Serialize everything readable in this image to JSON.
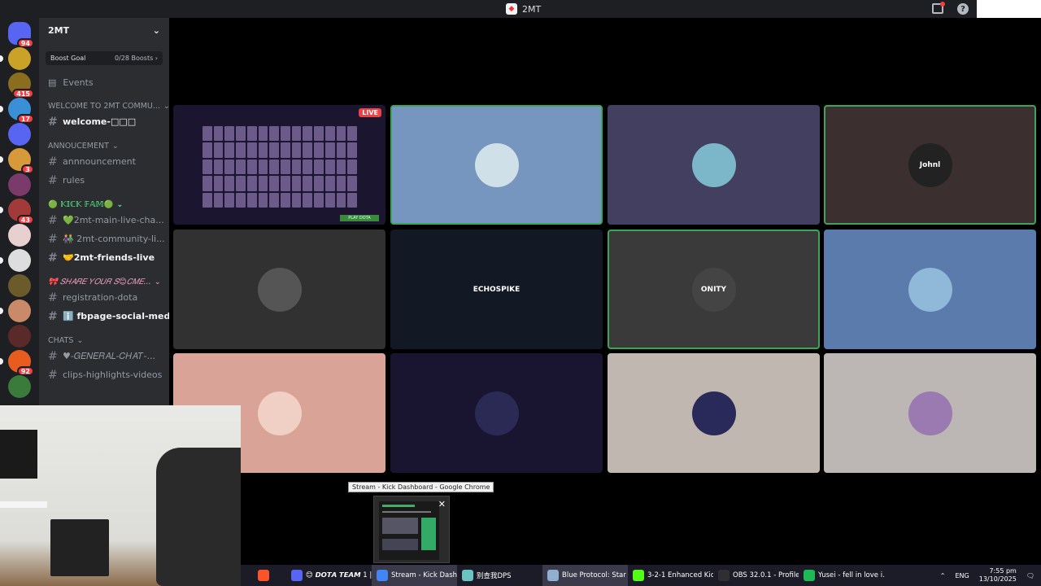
{
  "window": {
    "title": "2MT"
  },
  "server_rail": [
    {
      "name": "discord-home",
      "badge": "94",
      "color": "#5865f2"
    },
    {
      "name": "server-juicy",
      "badge": "",
      "color": "#c9a227"
    },
    {
      "name": "server-gold",
      "badge": "415",
      "color": "#8a6d1f"
    },
    {
      "name": "server-blue",
      "badge": "17",
      "color": "#3a8fd6"
    },
    {
      "name": "server-folder",
      "badge": "",
      "color": "#5865f2"
    },
    {
      "name": "server-2",
      "badge": "3",
      "color": "#d69a3a"
    },
    {
      "name": "server-3",
      "badge": "",
      "color": "#7a3a6a"
    },
    {
      "name": "server-4",
      "badge": "43",
      "color": "#a33a3a"
    },
    {
      "name": "server-cat",
      "badge": "",
      "color": "#e8d0d0"
    },
    {
      "name": "server-gm",
      "badge": "",
      "color": "#dddddd"
    },
    {
      "name": "server-sleepy",
      "badge": "",
      "color": "#6b5a2a"
    },
    {
      "name": "server-man",
      "badge": "",
      "color": "#c98a6a"
    },
    {
      "name": "server-dark",
      "badge": "",
      "color": "#5a2a2a"
    },
    {
      "name": "server-orange",
      "badge": "92",
      "color": "#e85d1f"
    },
    {
      "name": "server-green",
      "badge": "",
      "color": "#3a7a3a"
    }
  ],
  "sidebar": {
    "server_name": "2MT",
    "boost_goal": "Boost Goal",
    "boost_count": "0/28 Boosts",
    "events": "Events",
    "categories": [
      {
        "label": "WELCOME TO 2MT COMMU...",
        "style": "normal",
        "channels": [
          {
            "name": "welcome-□□□",
            "unread": true
          }
        ]
      },
      {
        "label": "ANNOUCEMENT",
        "style": "normal",
        "channels": [
          {
            "name": "annnouncement",
            "unread": false
          },
          {
            "name": "rules",
            "unread": false
          }
        ]
      },
      {
        "label": "🟢 𝕂𝕀ℂ𝕂 𝔽𝔸𝕄🟢",
        "style": "green",
        "channels": [
          {
            "name": "💚2mt-main-live-cha...",
            "unread": false
          },
          {
            "name": "👫 2mt-community-li...",
            "unread": false
          },
          {
            "name": "🤝2mt-friends-live",
            "unread": true
          }
        ]
      },
      {
        "label": "🎀 𝑆𝐻𝐴𝑅𝐸 𝑌𝑂𝑈𝑅 𝑆😊𝐶𝑀𝐸...",
        "style": "pink",
        "channels": [
          {
            "name": "registration-dota",
            "unread": false
          },
          {
            "name": "ℹ️ fbpage-social-medi...",
            "unread": true
          }
        ]
      },
      {
        "label": "CHATS",
        "style": "normal",
        "channels": [
          {
            "name": "♥-𝐺𝐸𝑁𝐸𝑅𝐴𝐿-𝐶𝐻𝐴𝑇-...",
            "unread": false
          },
          {
            "name": "clips-highlights-videos",
            "unread": false
          }
        ]
      }
    ]
  },
  "stage": {
    "live_label": "LIVE",
    "play_label": "PLAY DOTA",
    "tiles": [
      {
        "kind": "stream",
        "bg": "#1b1530",
        "speaking": false,
        "avatar_color": "",
        "avatar_text": ""
      },
      {
        "kind": "user",
        "bg": "#7796bf",
        "speaking": true,
        "avatar_color": "#cfe0e8",
        "avatar_text": ""
      },
      {
        "kind": "user",
        "bg": "#423f61",
        "speaking": false,
        "avatar_color": "#7bb6c9",
        "avatar_text": ""
      },
      {
        "kind": "user",
        "bg": "#3b2f2f",
        "speaking": true,
        "avatar_color": "#222222",
        "avatar_text": "Johnl"
      },
      {
        "kind": "user",
        "bg": "#313131",
        "speaking": false,
        "avatar_color": "#555555",
        "avatar_text": ""
      },
      {
        "kind": "user",
        "bg": "#121824",
        "speaking": false,
        "avatar_color": "#121824",
        "avatar_text": "ECHOSPIKE"
      },
      {
        "kind": "user",
        "bg": "#3a3a3a",
        "speaking": true,
        "avatar_color": "#444444",
        "avatar_text": "ONITY"
      },
      {
        "kind": "user",
        "bg": "#5b7bad",
        "speaking": false,
        "avatar_color": "#8fb8d9",
        "avatar_text": ""
      },
      {
        "kind": "user",
        "bg": "#d9a397",
        "speaking": false,
        "avatar_color": "#f0d0c4",
        "avatar_text": ""
      },
      {
        "kind": "user",
        "bg": "#191530",
        "speaking": false,
        "avatar_color": "#2a2a55",
        "avatar_text": ""
      },
      {
        "kind": "user",
        "bg": "#c0b7b1",
        "speaking": false,
        "avatar_color": "#2a2a5a",
        "avatar_text": ""
      },
      {
        "kind": "user",
        "bg": "#bcb7b5",
        "speaking": false,
        "avatar_color": "#9a7ab0",
        "avatar_text": ""
      }
    ]
  },
  "tooltip": "Stream - Kick Dashboard - Google Chrome",
  "taskbar": {
    "items": [
      {
        "label": "",
        "color": "#fb542b",
        "active": false
      },
      {
        "label": "😊 𝘿𝙊𝙏𝘼 𝙏𝙀𝘼𝙈 1 | ...",
        "color": "#5865f2",
        "active": false
      },
      {
        "label": "Stream - Kick Dash...",
        "color": "#4285f4",
        "active": true
      },
      {
        "label": "别查我DPS",
        "color": "#6ac3c0",
        "active": false
      },
      {
        "label": "Blue Protocol: Star ...",
        "color": "#8fb0d0",
        "active": true
      },
      {
        "label": "3-2-1 Enhanced Kic...",
        "color": "#53fc18",
        "active": false
      },
      {
        "label": "OBS 32.0.1 - Profile...",
        "color": "#302e31",
        "active": false
      },
      {
        "label": "Yusei - fell in love i...",
        "color": "#1db954",
        "active": false
      }
    ],
    "lang": "ENG",
    "time": "7:55 pm",
    "date": "13/10/2025"
  }
}
